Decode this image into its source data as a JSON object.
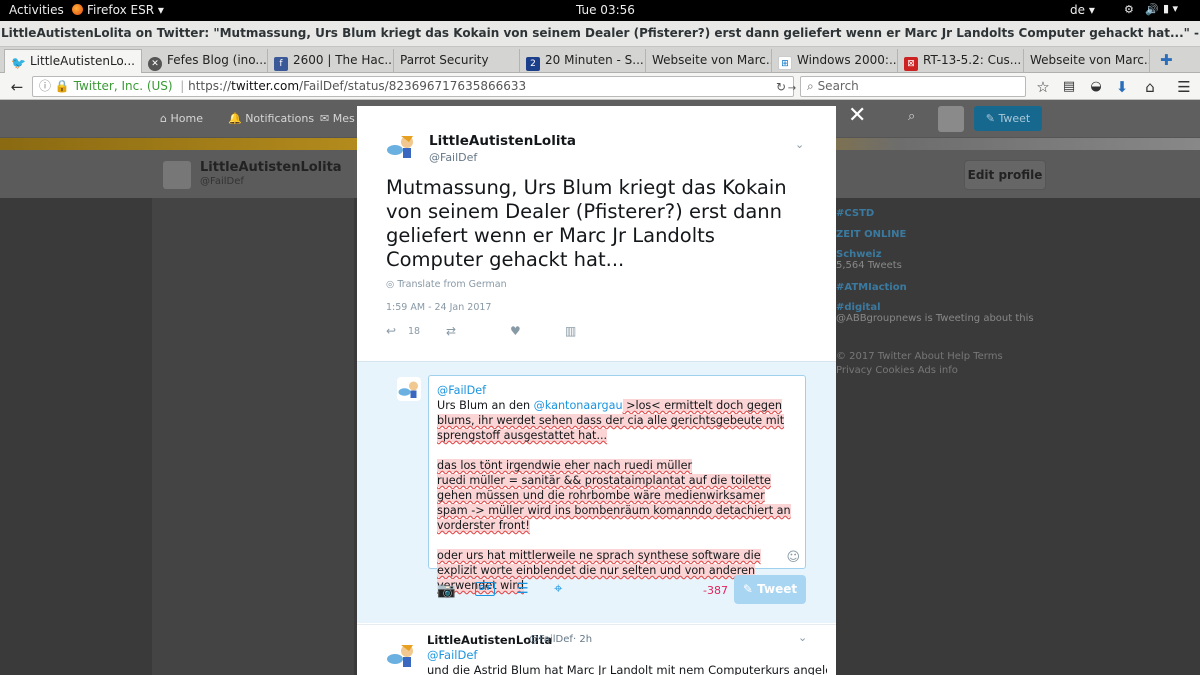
{
  "gnome": {
    "activities": "Activities",
    "app": "Firefox ESR",
    "clock": "Tue 03:56",
    "lang": "de"
  },
  "window": {
    "title": "LittleAutistenLolita on Twitter: \"Mutmassung, Urs Blum kriegt das Kokain von seinem Dealer (Pfisterer?) erst dann geliefert wenn er Marc Jr Landolts Computer gehackt hat...\" - Mozilla Firefox"
  },
  "tabs": [
    "LittleAutistenLo...",
    "Fefes Blog (ino...",
    "2600 | The Hac...",
    "Parrot Security",
    "20 Minuten - S...",
    "Webseite von Marc...",
    "Windows 2000:...",
    "RT-13-5.2: Cus...",
    "Webseite von Marc..."
  ],
  "nav": {
    "identity": "Twitter, Inc. (US)",
    "url_prefix": "https://",
    "url_host": "twitter.com",
    "url_path": "/FailDef/status/823696717635866633",
    "search_placeholder": "Search"
  },
  "twitter_nav": {
    "home": "Home",
    "notifications": "Notifications",
    "messages": "Mes",
    "tweet_btn": "Tweet",
    "edit_profile": "Edit profile"
  },
  "profile": {
    "name": "LittleAutistenLolita",
    "handle": "@FailDef"
  },
  "trends": [
    {
      "tag": "#CSTD",
      "sub": ""
    },
    {
      "tag": "ZEIT ONLINE",
      "sub": ""
    },
    {
      "tag": "Schweiz",
      "sub": "5,564 Tweets"
    },
    {
      "tag": "#ATMIaction",
      "sub": ""
    },
    {
      "tag": "#digital",
      "sub": "@ABBgroupnews is Tweeting about this"
    }
  ],
  "footer": {
    "line1": "© 2017 Twitter   About   Help   Terms",
    "line2": "Privacy   Cookies   Ads info"
  },
  "tweet": {
    "author": "LittleAutistenLolita",
    "handle": "@FailDef",
    "text": "Mutmassung, Urs Blum kriegt das Kokain von seinem Dealer (Pfisterer?) erst dann geliefert wenn er Marc Jr Landolts Computer gehackt hat...",
    "translate": "Translate from German",
    "timestamp": "1:59 AM - 24 Jan 2017",
    "reply_count": "18"
  },
  "reply": {
    "mention": "@FailDef",
    "line1_pre": "Urs Blum an den ",
    "line1_mention": "@kantonaargau",
    "line1_post": " >los< ermittelt doch gegen blums, ihr werdet sehen dass der cia alle gerichtsgebeute mit sprengstoff ausgestattet hat...",
    "para2": "das los tönt irgendwie eher nach ruedi müller",
    "para3": "ruedi müller = sanitär && prostataimplantat auf die toilette gehen müssen und die rohrbombe wäre medienwirksamer spam -> müller wird ins bombenräum komanndo detachiert an vorderster front!",
    "para4": "oder urs hat mittlerweile ne sprach synthese software die explizit worte einblendet die nur selten und von anderen verwendet wird",
    "counter": "-387",
    "tweet_btn": "Tweet",
    "gif": "GIF"
  },
  "next_tweet": {
    "author": "LittleAutistenLolita",
    "handle": "@FailDef",
    "age": "· 2h",
    "mention": "@FailDef",
    "text": "und die Astrid Blum hat Marc Jr Landolt mit nem Computerkurs angelockt, weil"
  }
}
